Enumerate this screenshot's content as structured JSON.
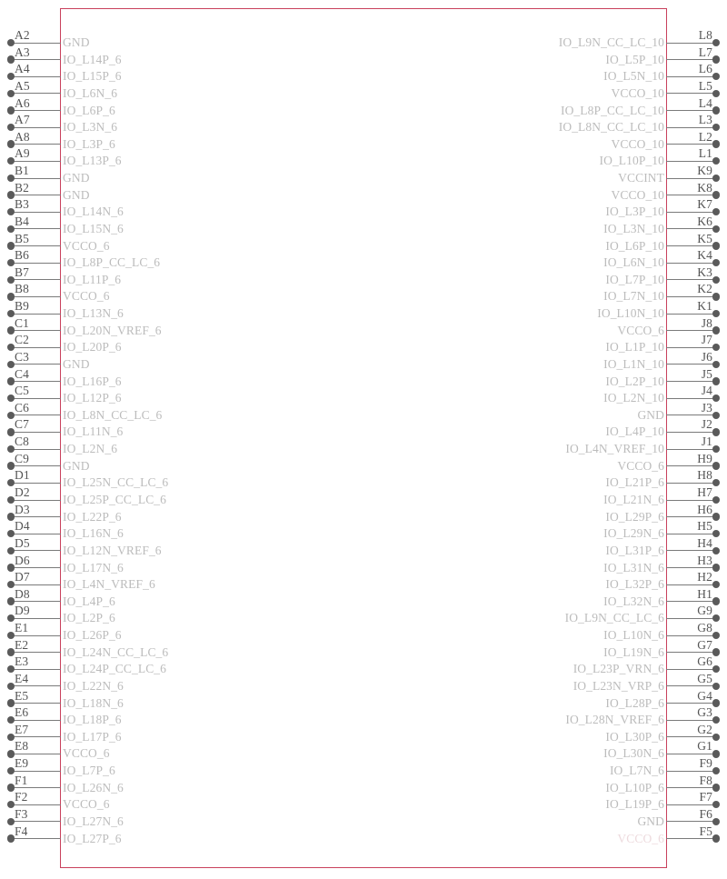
{
  "symbol": {
    "body_color": "#c9405c",
    "pin_line_color": "#7a7a7a",
    "pin_dot_color": "#5a5a5a",
    "pin_name_color": "#bcbcbc",
    "pin_number_color": "#555555"
  },
  "left_pins": [
    {
      "number": "A2",
      "name": "GND"
    },
    {
      "number": "A3",
      "name": "IO_L14P_6"
    },
    {
      "number": "A4",
      "name": "IO_L15P_6"
    },
    {
      "number": "A5",
      "name": "IO_L6N_6"
    },
    {
      "number": "A6",
      "name": "IO_L6P_6"
    },
    {
      "number": "A7",
      "name": "IO_L3N_6"
    },
    {
      "number": "A8",
      "name": "IO_L3P_6"
    },
    {
      "number": "A9",
      "name": "IO_L13P_6"
    },
    {
      "number": "B1",
      "name": "GND"
    },
    {
      "number": "B2",
      "name": "GND"
    },
    {
      "number": "B3",
      "name": "IO_L14N_6"
    },
    {
      "number": "B4",
      "name": "IO_L15N_6"
    },
    {
      "number": "B5",
      "name": "VCCO_6"
    },
    {
      "number": "B6",
      "name": "IO_L8P_CC_LC_6"
    },
    {
      "number": "B7",
      "name": "IO_L11P_6"
    },
    {
      "number": "B8",
      "name": "VCCO_6"
    },
    {
      "number": "B9",
      "name": "IO_L13N_6"
    },
    {
      "number": "C1",
      "name": "IO_L20N_VREF_6"
    },
    {
      "number": "C2",
      "name": "IO_L20P_6"
    },
    {
      "number": "C3",
      "name": "GND"
    },
    {
      "number": "C4",
      "name": "IO_L16P_6"
    },
    {
      "number": "C5",
      "name": "IO_L12P_6"
    },
    {
      "number": "C6",
      "name": "IO_L8N_CC_LC_6"
    },
    {
      "number": "C7",
      "name": "IO_L11N_6"
    },
    {
      "number": "C8",
      "name": "IO_L2N_6"
    },
    {
      "number": "C9",
      "name": "GND"
    },
    {
      "number": "D1",
      "name": "IO_L25N_CC_LC_6"
    },
    {
      "number": "D2",
      "name": "IO_L25P_CC_LC_6"
    },
    {
      "number": "D3",
      "name": "IO_L22P_6"
    },
    {
      "number": "D4",
      "name": "IO_L16N_6"
    },
    {
      "number": "D5",
      "name": "IO_L12N_VREF_6"
    },
    {
      "number": "D6",
      "name": "IO_L17N_6"
    },
    {
      "number": "D7",
      "name": "IO_L4N_VREF_6"
    },
    {
      "number": "D8",
      "name": "IO_L4P_6"
    },
    {
      "number": "D9",
      "name": "IO_L2P_6"
    },
    {
      "number": "E1",
      "name": "IO_L26P_6"
    },
    {
      "number": "E2",
      "name": "IO_L24N_CC_LC_6"
    },
    {
      "number": "E3",
      "name": "IO_L24P_CC_LC_6"
    },
    {
      "number": "E4",
      "name": "IO_L22N_6"
    },
    {
      "number": "E5",
      "name": "IO_L18N_6"
    },
    {
      "number": "E6",
      "name": "IO_L18P_6"
    },
    {
      "number": "E7",
      "name": "IO_L17P_6"
    },
    {
      "number": "E8",
      "name": "VCCO_6"
    },
    {
      "number": "E9",
      "name": "IO_L7P_6"
    },
    {
      "number": "F1",
      "name": "IO_L26N_6"
    },
    {
      "number": "F2",
      "name": "VCCO_6"
    },
    {
      "number": "F3",
      "name": "IO_L27N_6"
    },
    {
      "number": "F4",
      "name": "IO_L27P_6"
    }
  ],
  "right_pins": [
    {
      "number": "L8",
      "name": "IO_L9N_CC_LC_10"
    },
    {
      "number": "L7",
      "name": "IO_L5P_10"
    },
    {
      "number": "L6",
      "name": "IO_L5N_10"
    },
    {
      "number": "L5",
      "name": "VCCO_10"
    },
    {
      "number": "L4",
      "name": "IO_L8P_CC_LC_10"
    },
    {
      "number": "L3",
      "name": "IO_L8N_CC_LC_10"
    },
    {
      "number": "L2",
      "name": "VCCO_10"
    },
    {
      "number": "L1",
      "name": "IO_L10P_10"
    },
    {
      "number": "K9",
      "name": "VCCINT"
    },
    {
      "number": "K8",
      "name": "VCCO_10"
    },
    {
      "number": "K7",
      "name": "IO_L3P_10"
    },
    {
      "number": "K6",
      "name": "IO_L3N_10"
    },
    {
      "number": "K5",
      "name": "IO_L6P_10"
    },
    {
      "number": "K4",
      "name": "IO_L6N_10"
    },
    {
      "number": "K3",
      "name": "IO_L7P_10"
    },
    {
      "number": "K2",
      "name": "IO_L7N_10"
    },
    {
      "number": "K1",
      "name": "IO_L10N_10"
    },
    {
      "number": "J8",
      "name": "VCCO_6"
    },
    {
      "number": "J7",
      "name": "IO_L1P_10"
    },
    {
      "number": "J6",
      "name": "IO_L1N_10"
    },
    {
      "number": "J5",
      "name": "IO_L2P_10"
    },
    {
      "number": "J4",
      "name": "IO_L2N_10"
    },
    {
      "number": "J3",
      "name": "GND"
    },
    {
      "number": "J2",
      "name": "IO_L4P_10"
    },
    {
      "number": "J1",
      "name": "IO_L4N_VREF_10"
    },
    {
      "number": "H9",
      "name": "VCCO_6"
    },
    {
      "number": "H8",
      "name": "IO_L21P_6"
    },
    {
      "number": "H7",
      "name": "IO_L21N_6"
    },
    {
      "number": "H6",
      "name": "IO_L29P_6"
    },
    {
      "number": "H5",
      "name": "IO_L29N_6"
    },
    {
      "number": "H4",
      "name": "IO_L31P_6"
    },
    {
      "number": "H3",
      "name": "IO_L31N_6"
    },
    {
      "number": "H2",
      "name": "IO_L32P_6"
    },
    {
      "number": "H1",
      "name": "IO_L32N_6"
    },
    {
      "number": "G9",
      "name": "IO_L9N_CC_LC_6"
    },
    {
      "number": "G8",
      "name": "IO_L10N_6"
    },
    {
      "number": "G7",
      "name": "IO_L19N_6"
    },
    {
      "number": "G6",
      "name": "IO_L23P_VRN_6"
    },
    {
      "number": "G5",
      "name": "IO_L23N_VRP_6"
    },
    {
      "number": "G4",
      "name": "IO_L28P_6"
    },
    {
      "number": "G3",
      "name": "IO_L28N_VREF_6"
    },
    {
      "number": "G2",
      "name": "IO_L30P_6"
    },
    {
      "number": "G1",
      "name": "IO_L30N_6"
    },
    {
      "number": "F9",
      "name": "IO_L7N_6"
    },
    {
      "number": "F8",
      "name": "IO_L10P_6"
    },
    {
      "number": "F7",
      "name": "IO_L19P_6"
    },
    {
      "number": "F6",
      "name": "GND"
    },
    {
      "number": "F5",
      "name": "VCCO_6"
    }
  ]
}
